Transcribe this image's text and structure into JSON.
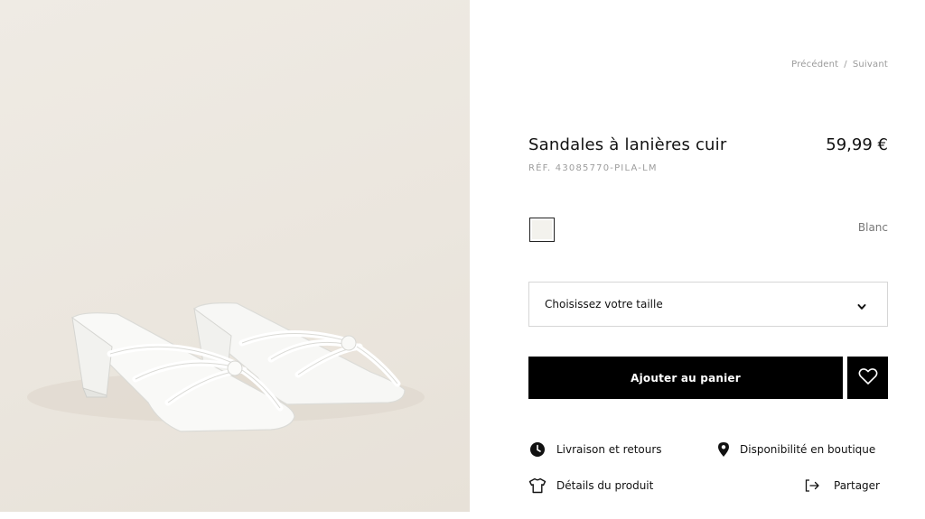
{
  "product_image": {
    "alt_subject": "white knotted strappy block-heel sandals"
  },
  "navigation": {
    "previous": "Précédent",
    "separator": "/",
    "next": "Suivant"
  },
  "product": {
    "title": "Sandales à lanières cuir",
    "price": "59,99 €",
    "reference": "RÉF. 43085770-PILA-LM"
  },
  "color": {
    "selected_name": "Blanc",
    "swatch_hex": "#f3f2ed"
  },
  "size": {
    "placeholder": "Choisissez votre taille"
  },
  "actions": {
    "add_to_cart": "Ajouter au panier"
  },
  "info_links": {
    "delivery": "Livraison et retours",
    "store_availability": "Disponibilité en boutique",
    "product_details": "Détails du produit",
    "share": "Partager"
  },
  "icons": {
    "delivery": "clock-icon",
    "store": "location-pin-icon",
    "details": "tshirt-icon",
    "share": "share-arrow-icon",
    "wishlist": "heart-icon",
    "dropdown": "chevron-down-icon"
  }
}
